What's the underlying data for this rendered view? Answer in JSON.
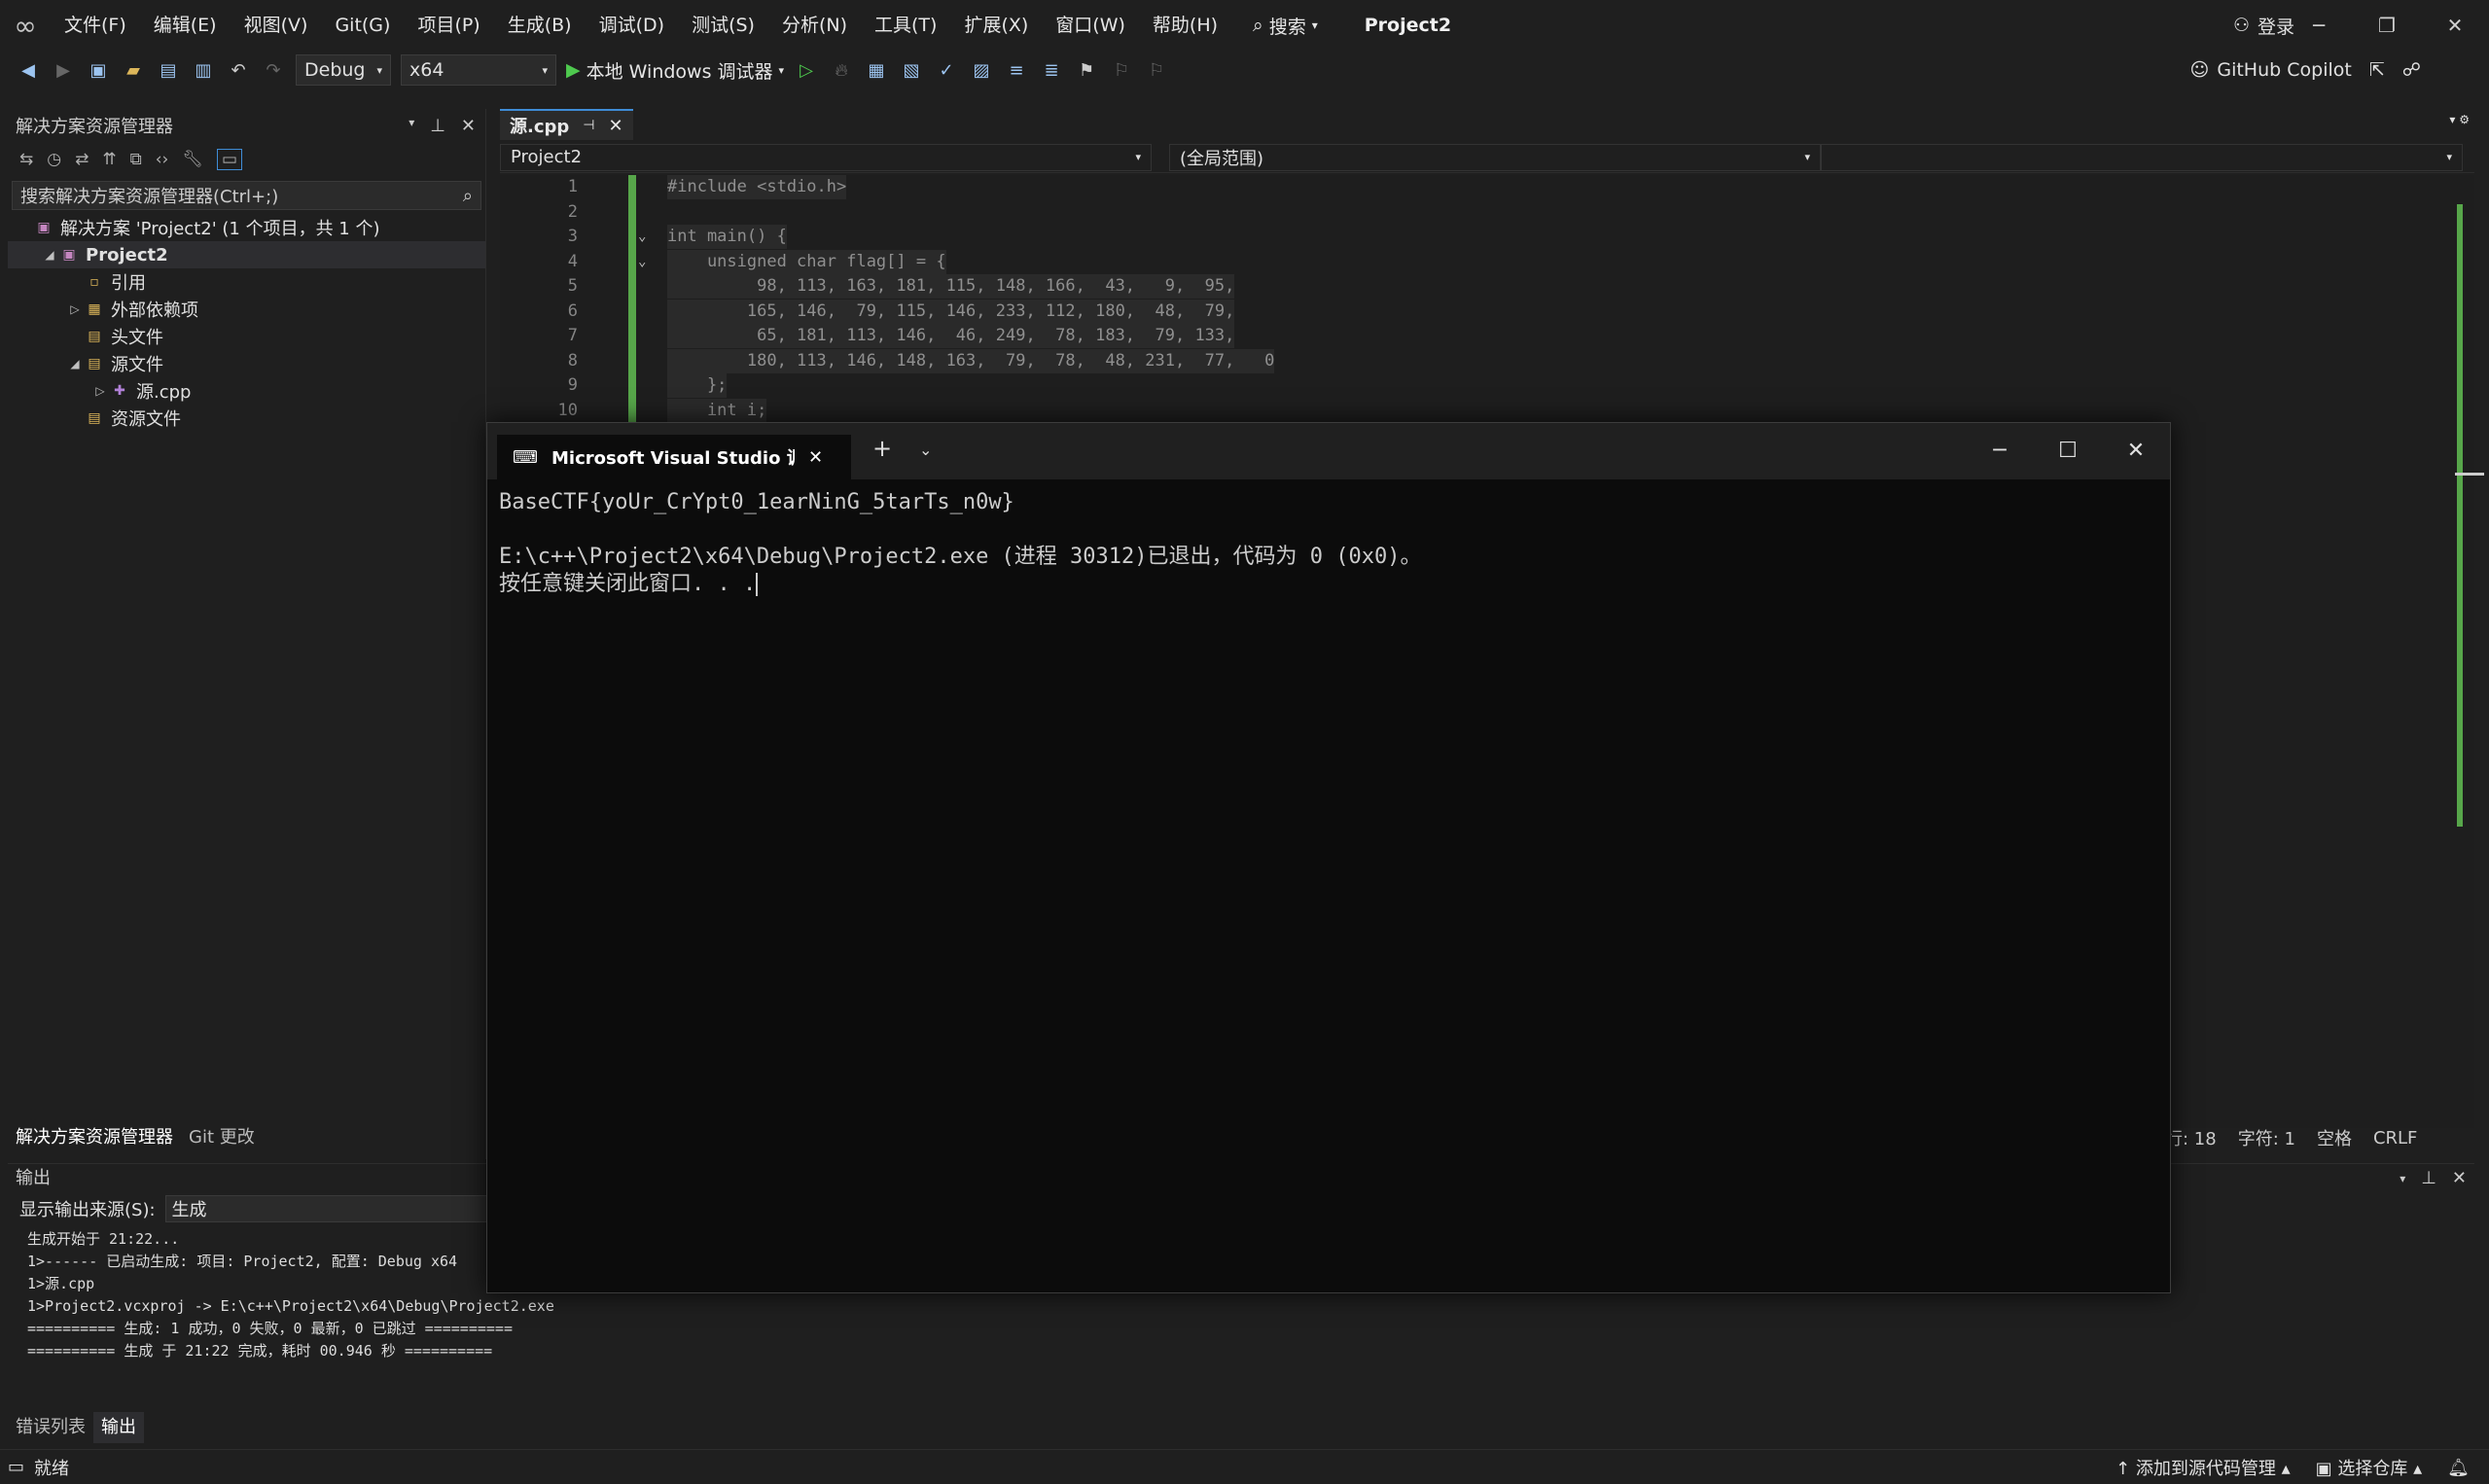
{
  "menubar": {
    "items": [
      "文件(F)",
      "编辑(E)",
      "视图(V)",
      "Git(G)",
      "项目(P)",
      "生成(B)",
      "调试(D)",
      "测试(S)",
      "分析(N)",
      "工具(T)",
      "扩展(X)",
      "窗口(W)",
      "帮助(H)"
    ],
    "search_label": "搜索",
    "project_title": "Project2",
    "login_label": "登录"
  },
  "toolbar": {
    "config": "Debug",
    "platform": "x64",
    "run_label": "本地 Windows 调试器",
    "copilot_label": "GitHub Copilot"
  },
  "solution_explorer": {
    "title": "解决方案资源管理器",
    "search_placeholder": "搜索解决方案资源管理器(Ctrl+;)",
    "tree": [
      {
        "label": "解决方案 'Project2' (1 个项目，共 1 个)",
        "level": 0,
        "twisty": ""
      },
      {
        "label": "Project2",
        "level": 1,
        "twisty": "open",
        "bold": true
      },
      {
        "label": "引用",
        "level": 2,
        "twisty": ""
      },
      {
        "label": "外部依赖项",
        "level": 2,
        "twisty": "closed"
      },
      {
        "label": "头文件",
        "level": 2,
        "twisty": ""
      },
      {
        "label": "源文件",
        "level": 2,
        "twisty": "open"
      },
      {
        "label": "源.cpp",
        "level": 3,
        "twisty": "closed"
      },
      {
        "label": "资源文件",
        "level": 2,
        "twisty": ""
      }
    ],
    "bottom_tabs": [
      "解决方案资源管理器",
      "Git 更改"
    ]
  },
  "editor": {
    "tab_label": "源.cpp",
    "nav_project": "Project2",
    "nav_scope": "(全局范围)",
    "lines": [
      {
        "n": "1",
        "text": "#include <stdio.h>"
      },
      {
        "n": "2",
        "text": ""
      },
      {
        "n": "3",
        "text": "int main() {"
      },
      {
        "n": "4",
        "text": "    unsigned char flag[] = {"
      },
      {
        "n": "5",
        "text": "         98, 113, 163, 181, 115, 148, 166,  43,   9,  95,"
      },
      {
        "n": "6",
        "text": "        165, 146,  79, 115, 146, 233, 112, 180,  48,  79,"
      },
      {
        "n": "7",
        "text": "         65, 181, 113, 146,  46, 249,  78, 183,  79, 133,"
      },
      {
        "n": "8",
        "text": "        180, 113, 146, 148, 163,  79,  78,  48, 231,  77,   0"
      },
      {
        "n": "9",
        "text": "    };"
      },
      {
        "n": "10",
        "text": "    int i;"
      }
    ],
    "status": {
      "line": "行: 18",
      "char": "字符: 1",
      "space": "空格",
      "eol": "CRLF"
    }
  },
  "output": {
    "title": "输出",
    "source_label": "显示输出来源(S):",
    "source_value": "生成",
    "lines": [
      "生成开始于 21:22...",
      "1>------ 已启动生成: 项目: Project2, 配置: Debug x64",
      "1>源.cpp",
      "1>Project2.vcxproj -> E:\\c++\\Project2\\x64\\Debug\\Project2.exe",
      "========== 生成: 1 成功，0 失败，0 最新，0 已跳过 ==========",
      "========== 生成 于 21:22 完成，耗时 00.946 秒 =========="
    ],
    "tabs": [
      "错误列表",
      "输出"
    ]
  },
  "statusbar": {
    "ready": "就绪",
    "add_source": "添加到源代码管理",
    "select_repo": "选择仓库"
  },
  "console": {
    "tab_title": "Microsoft Visual Studio 调试控制台",
    "lines": [
      "BaseCTF{yoUr_CrYpt0_1earNinG_5tarTs_n0w}",
      "",
      "E:\\c++\\Project2\\x64\\Debug\\Project2.exe (进程 30312)已退出，代码为 0 (0x0)。",
      "按任意键关闭此窗口. . ."
    ]
  }
}
